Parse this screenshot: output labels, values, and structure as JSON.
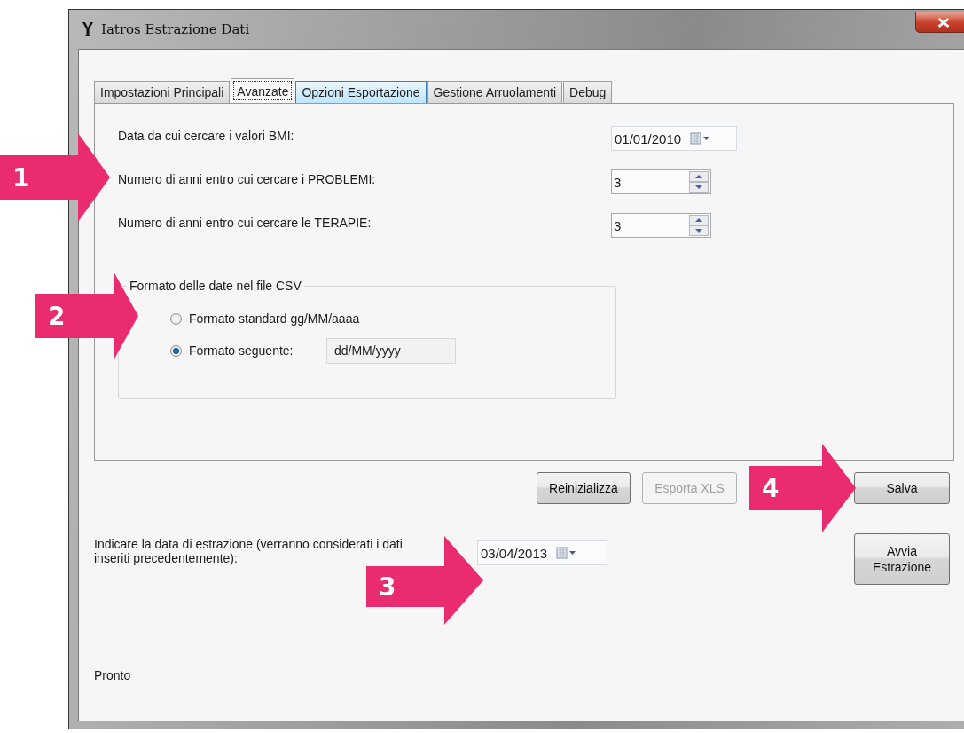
{
  "window": {
    "title": "Iatros Estrazione Dati"
  },
  "tabs": [
    {
      "label": "Impostazioni Principali",
      "selected": false,
      "hover": false
    },
    {
      "label": "Avanzate",
      "selected": true,
      "hover": false
    },
    {
      "label": "Opzioni Esportazione",
      "selected": false,
      "hover": true
    },
    {
      "label": "Gestione Arruolamenti",
      "selected": false,
      "hover": false
    },
    {
      "label": "Debug",
      "selected": false,
      "hover": false
    }
  ],
  "settings": [
    {
      "label": "Data da cui cercare i valori BMI:",
      "kind": "date",
      "value": "01/01/2010"
    },
    {
      "label": "Numero di anni entro cui cercare i PROBLEMI:",
      "kind": "spin",
      "value": "3"
    },
    {
      "label": "Numero di anni entro cui cercare le TERAPIE:",
      "kind": "spin",
      "value": "3"
    }
  ],
  "date_format_group": {
    "legend": "Formato delle date nel file CSV",
    "options": [
      {
        "label": "Formato standard gg/MM/aaaa",
        "selected": false
      },
      {
        "label": "Formato seguente:",
        "selected": true,
        "value": "dd/MM/yyyy"
      }
    ]
  },
  "buttons": [
    {
      "label": "Reinizializza",
      "disabled": false
    },
    {
      "label": "Esporta XLS",
      "disabled": true
    },
    {
      "label": "Salva",
      "disabled": false
    }
  ],
  "extraction": {
    "label": "Indicare la data di estrazione (verranno considerati i dati inseriti precedentemente):",
    "date": "03/04/2013",
    "button": "Avvia Estrazione"
  },
  "status": "Pronto",
  "annotations": [
    {
      "label": "1"
    },
    {
      "label": "2"
    },
    {
      "label": "3"
    },
    {
      "label": "4"
    }
  ]
}
